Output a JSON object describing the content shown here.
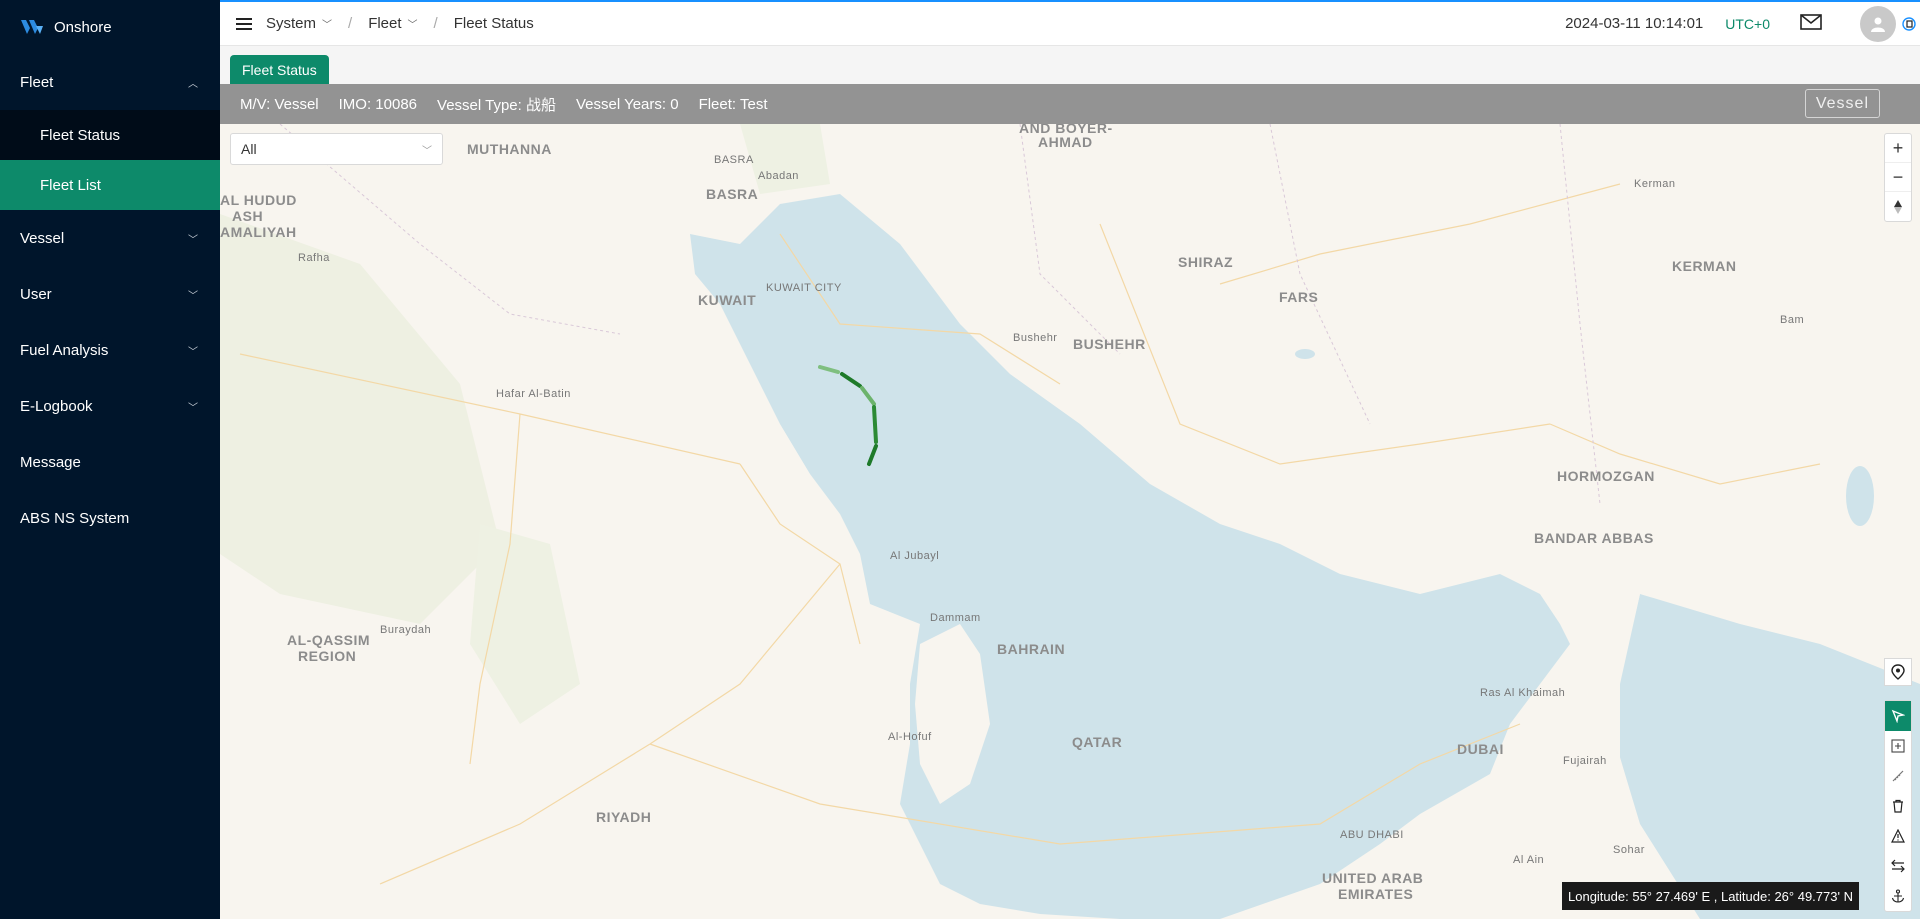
{
  "app": {
    "name": "Onshore"
  },
  "sidebar": {
    "items": [
      {
        "label": "Fleet",
        "expanded": true
      },
      {
        "label": "Fleet Status"
      },
      {
        "label": "Fleet List",
        "active": true
      },
      {
        "label": "Vessel"
      },
      {
        "label": "User"
      },
      {
        "label": "Fuel Analysis"
      },
      {
        "label": "E-Logbook"
      },
      {
        "label": "Message"
      },
      {
        "label": "ABS NS System"
      }
    ]
  },
  "header": {
    "breadcrumb": [
      "System",
      "Fleet",
      "Fleet Status"
    ],
    "datetime": "2024-03-11 10:14:01",
    "timezone": "UTC+0"
  },
  "tabs": [
    {
      "label": "Fleet Status"
    }
  ],
  "vessel_info": {
    "mv": "M/V:  Vessel",
    "imo": "IMO:  10086",
    "type": "Vessel Type:  战船",
    "years": "Vessel Years:  0",
    "fleet": "Fleet:  Test",
    "button": "Vessel"
  },
  "map": {
    "filter_value": "All",
    "zoom_in": "+",
    "zoom_out": "−",
    "labels": {
      "muthanna": "MUTHANNA",
      "basra_region": "BASRA",
      "basra_city": "BASRA",
      "abadan": "Abadan",
      "and_boyer": "AND BOYER-",
      "ahmad": "AHMAD",
      "al_hudud": "AL HUDUD",
      "ash": "ASH",
      "amaliyah": "AMALIYAH",
      "rafha": "Rafha",
      "kuwait": "KUWAIT",
      "kuwait_city": "KUWAIT CITY",
      "hafar": "Hafar Al-Batin",
      "shiraz": "SHIRAZ",
      "fars": "FARS",
      "bushehr_city": "Bushehr",
      "bushehr": "BUSHEHR",
      "kerman_city": "Kerman",
      "kerman": "KERMAN",
      "bam": "Bam",
      "hormozgan": "HORMOZGAN",
      "bandar": "BANDAR ABBAS",
      "al_jubayl": "Al Jubayl",
      "dammam": "Dammam",
      "bahrain": "BAHRAIN",
      "al_qassim": "AL-QASSIM",
      "region": "REGION",
      "buraydah": "Buraydah",
      "qatar": "QATAR",
      "al_hofuf": "Al-Hofuf",
      "riyadh": "RIYADH",
      "ras_khaimah": "Ras Al Khaimah",
      "dubai": "DUBAI",
      "fujairah": "Fujairah",
      "abu_dhabi": "ABU DHABI",
      "al_ain": "Al Ain",
      "sohar": "Sohar",
      "uae1": "UNITED ARAB",
      "uae2": "EMIRATES"
    },
    "coordinates": "Longitude:  55° 27.469' E ,  Latitude:  26° 49.773' N"
  },
  "colors": {
    "sidebar_bg": "#00152b",
    "accent": "#0d8a6a",
    "info_bar": "#939393",
    "track": "#1e8a2e"
  }
}
